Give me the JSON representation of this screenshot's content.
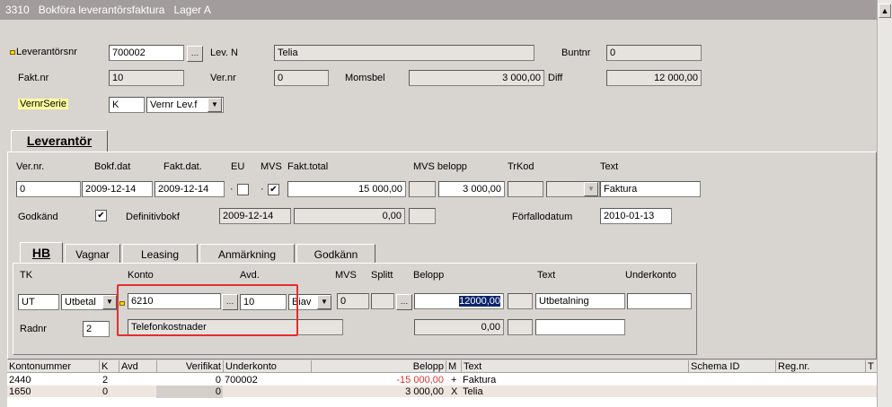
{
  "window": {
    "code": "3310",
    "title": "Bokföra leverantörsfaktura",
    "lager": "Lager A"
  },
  "header": {
    "leverantorsnr_label": "Leverantörsnr",
    "leverantorsnr": "700002",
    "lev_n_label": "Lev. N",
    "lev_n": "Telia",
    "buntnr_label": "Buntnr",
    "buntnr": "0",
    "fakt_nr_label": "Fakt.nr",
    "fakt_nr": "10",
    "ver_nr_label": "Ver.nr",
    "ver_nr": "0",
    "momsbel_label": "Momsbel",
    "momsbel": "3 000,00",
    "diff_label": "Diff",
    "diff": "12 000,00",
    "vernrserie_label": "VernrSerie",
    "vernrserie": "K",
    "vernrserie_sel": "Vernr Lev.f"
  },
  "tabs_main": [
    {
      "label": "Leverantör"
    }
  ],
  "lev": {
    "h_ver_nr": "Ver.nr.",
    "h_bokf_dat": "Bokf.dat",
    "h_fakt_dat": "Fakt.dat.",
    "h_eu": "EU",
    "h_mvs": "MVS",
    "h_fakt_total": "Fakt.total",
    "h_mvs_belopp": "MVS belopp",
    "h_trkod": "TrKod",
    "h_text": "Text",
    "ver_nr": "0",
    "bokf_dat": "2009-12-14",
    "fakt_dat": "2009-12-14",
    "eu_checked": "",
    "mvs_checked": "✔",
    "fakt_total": "15 000,00",
    "mvs_belopp": "3 000,00",
    "text": "Faktura",
    "godkand_label": "Godkänd",
    "godkand_checked": "✔",
    "definitivbokf_label": "Definitivbokf",
    "definitivbokf": "2009-12-14",
    "def_amount": "0,00",
    "forfallodatum_label": "Förfallodatum",
    "forfallodatum": "2010-01-13"
  },
  "tabs_sub": [
    {
      "label": "HB"
    },
    {
      "label": "Vagnar"
    },
    {
      "label": "Leasing"
    },
    {
      "label": "Anmärkning"
    },
    {
      "label": "Godkänn"
    }
  ],
  "hb": {
    "h_tk": "TK",
    "h_konto": "Konto",
    "h_avd": "Avd.",
    "h_mvs": "MVS",
    "h_splitt": "Splitt",
    "h_belopp": "Belopp",
    "h_text": "Text",
    "h_underkonto": "Underkonto",
    "tk": "UT",
    "tk_sel": "Utbetal",
    "konto": "6210",
    "avd": "10",
    "avd_sel": "Biav",
    "mvs": "0",
    "belopp": "12000,00",
    "text": "Utbetalning",
    "radnr_label": "Radnr",
    "radnr": "2",
    "konto_name": "Telefonkostnader",
    "belopp2": "0,00"
  },
  "grid": {
    "headers": [
      "Kontonummer",
      "K",
      "Avd",
      "Verifikat",
      "Underkonto",
      "Belopp",
      "M",
      "Text",
      "Schema ID",
      "Reg.nr.",
      "T"
    ],
    "rows": [
      {
        "konto": "2440",
        "k": "2",
        "avd": "",
        "verifikat": "0",
        "underkonto": "700002",
        "belopp": "-15 000,00",
        "m": "+",
        "text": "Faktura"
      },
      {
        "konto": "1650",
        "k": "0",
        "avd": "",
        "verifikat": "0",
        "underkonto": "",
        "belopp": "3 000,00",
        "m": "X",
        "text": "Telia"
      }
    ]
  },
  "colors": {
    "negative": "#e0302f",
    "selection": "#0a246a",
    "highlight_box": "#e0302f"
  }
}
